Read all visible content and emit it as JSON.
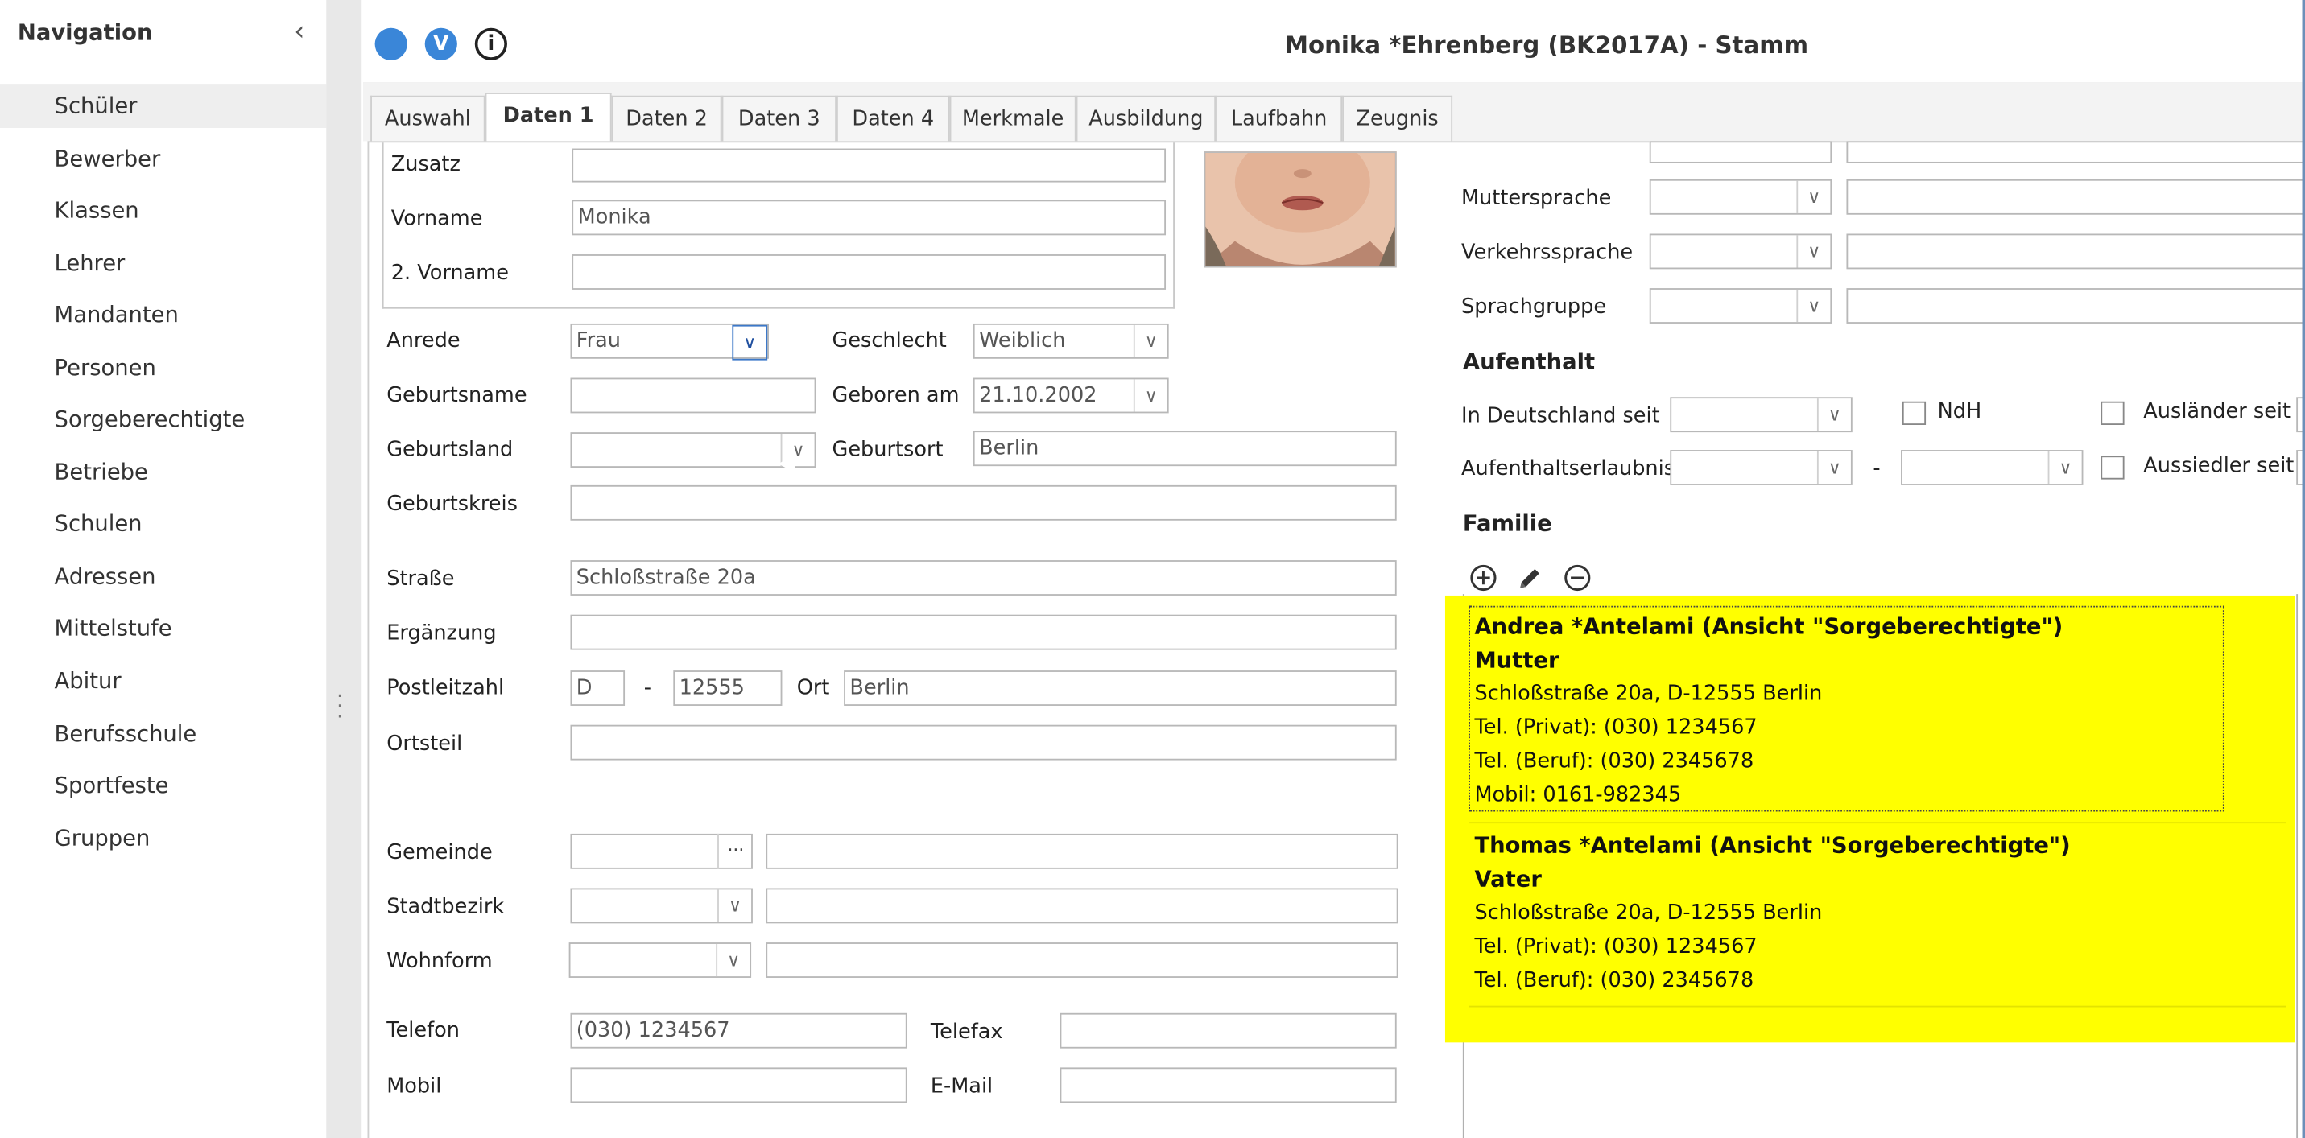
{
  "navigation": {
    "title": "Navigation",
    "items": [
      {
        "label": "Schüler"
      },
      {
        "label": "Bewerber"
      },
      {
        "label": "Klassen"
      },
      {
        "label": "Lehrer"
      },
      {
        "label": "Mandanten"
      },
      {
        "label": "Personen"
      },
      {
        "label": "Sorgeberechtigte"
      },
      {
        "label": "Betriebe"
      },
      {
        "label": "Schulen"
      },
      {
        "label": "Adressen"
      },
      {
        "label": "Mittelstufe"
      },
      {
        "label": "Abitur"
      },
      {
        "label": "Berufsschule"
      },
      {
        "label": "Sportfeste"
      },
      {
        "label": "Gruppen"
      }
    ],
    "active_item": "Schüler"
  },
  "header": {
    "title": "Monika *Ehrenberg (BK2017A) - Stamm",
    "icons": [
      "circle-icon",
      "v-icon",
      "info-icon"
    ],
    "v_letter": "V",
    "info_letter": "i"
  },
  "tabs": [
    {
      "label": "Auswahl"
    },
    {
      "label": "Daten 1"
    },
    {
      "label": "Daten 2"
    },
    {
      "label": "Daten 3"
    },
    {
      "label": "Daten 4"
    },
    {
      "label": "Merkmale"
    },
    {
      "label": "Ausbildung"
    },
    {
      "label": "Laufbahn"
    },
    {
      "label": "Zeugnis"
    }
  ],
  "active_tab": "Daten 1",
  "form": {
    "zusatz": {
      "label": "Zusatz",
      "value": ""
    },
    "vorname": {
      "label": "Vorname",
      "value": "Monika"
    },
    "vorname2": {
      "label": "2. Vorname",
      "value": ""
    },
    "anrede": {
      "label": "Anrede",
      "value": "Frau"
    },
    "geschlecht": {
      "label": "Geschlecht",
      "value": "Weiblich"
    },
    "geburtsname": {
      "label": "Geburtsname",
      "value": ""
    },
    "geboren_am": {
      "label": "Geboren am",
      "value": "21.10.2002"
    },
    "geburtsland": {
      "label": "Geburtsland",
      "value": ""
    },
    "geburtsort": {
      "label": "Geburtsort",
      "value": "Berlin"
    },
    "geburtskreis": {
      "label": "Geburtskreis",
      "value": ""
    },
    "strasse": {
      "label": "Straße",
      "value": "Schloßstraße 20a"
    },
    "ergaenzung": {
      "label": "Ergänzung",
      "value": ""
    },
    "postleitzahl": {
      "label": "Postleitzahl",
      "country": "D",
      "separator": "-",
      "value": "12555"
    },
    "ort": {
      "label": "Ort",
      "value": "Berlin"
    },
    "ortsteil": {
      "label": "Ortsteil",
      "value": ""
    },
    "gemeinde": {
      "label": "Gemeinde",
      "value": "",
      "button": "···"
    },
    "stadtbezirk": {
      "label": "Stadtbezirk",
      "value": ""
    },
    "wohnform": {
      "label": "Wohnform",
      "value": ""
    },
    "telefon": {
      "label": "Telefon",
      "value": "(030) 1234567"
    },
    "telefax": {
      "label": "Telefax",
      "value": ""
    },
    "mobil": {
      "label": "Mobil",
      "value": ""
    },
    "email": {
      "label": "E-Mail",
      "value": ""
    }
  },
  "right": {
    "muttersprache": {
      "label": "Muttersprache",
      "value": ""
    },
    "verkehrssprache": {
      "label": "Verkehrssprache",
      "value": ""
    },
    "sprachgruppe": {
      "label": "Sprachgruppe",
      "value": ""
    },
    "aufenthalt_heading": "Aufenthalt",
    "in_deutschland_seit": {
      "label": "In Deutschland seit",
      "value": ""
    },
    "ndh": {
      "label": "NdH",
      "checked": false
    },
    "auslaender_seit": {
      "label": "Ausländer seit",
      "checked": false
    },
    "aufenthaltserlaubnis": {
      "label": "Aufenthaltserlaubnis",
      "separator": "-"
    },
    "aussiedler_seit": {
      "label": "Aussiedler seit",
      "checked": false
    },
    "familie_heading": "Familie",
    "familie_toolbar": [
      "add-circle-icon",
      "pencil-icon",
      "remove-circle-icon"
    ],
    "familie": [
      {
        "name": "Andrea *Antelami (Ansicht \"Sorgeberechtigte\")",
        "role": "Mutter",
        "address": "Schloßstraße 20a, D-12555 Berlin",
        "privat": "Tel. (Privat): (030) 1234567",
        "beruf": "Tel. (Beruf): (030) 2345678",
        "mobil": "Mobil: 0161-982345"
      },
      {
        "name": "Thomas *Antelami (Ansicht \"Sorgeberechtigte\")",
        "role": "Vater",
        "address": "Schloßstraße 20a, D-12555 Berlin",
        "privat": "Tel. (Privat): (030) 1234567",
        "beruf": "Tel. (Beruf): (030) 2345678"
      }
    ],
    "highlight_color": "#ffff00"
  },
  "colors": {
    "accent_blue": "#3a86d8",
    "highlight_yellow": "#ffff00"
  }
}
